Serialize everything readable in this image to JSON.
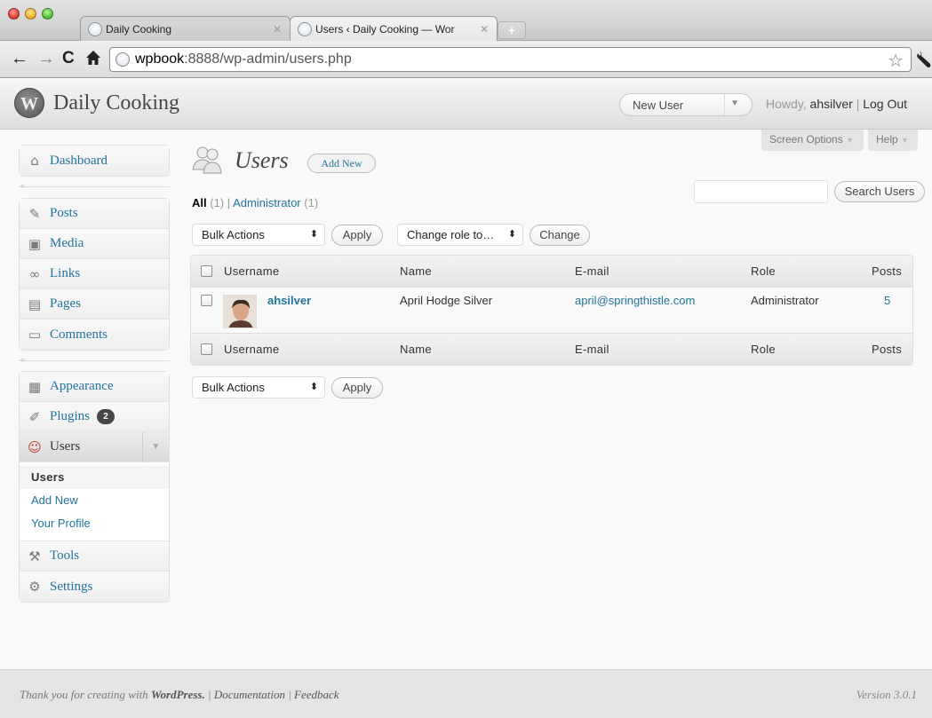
{
  "browser": {
    "tabs": [
      {
        "title": "Daily Cooking",
        "close": "✕"
      },
      {
        "title": "Users ‹ Daily Cooking — Wor",
        "close": "✕"
      }
    ],
    "new_tab": "+",
    "url_host": "wpbook",
    "url_rest": ":8888/wp-admin/users.php"
  },
  "header": {
    "site_title": "Daily Cooking",
    "logo_letter": "W",
    "favorite_action": "New User",
    "howdy": "Howdy,",
    "username": "ahsilver",
    "separator": "|",
    "logout": "Log Out"
  },
  "sidebar": {
    "group1": [
      {
        "label": "Dashboard",
        "icon": "home-icon"
      }
    ],
    "group2": [
      {
        "label": "Posts",
        "icon": "pin-icon"
      },
      {
        "label": "Media",
        "icon": "media-icon"
      },
      {
        "label": "Links",
        "icon": "link-icon"
      },
      {
        "label": "Pages",
        "icon": "pages-icon"
      },
      {
        "label": "Comments",
        "icon": "comment-icon"
      }
    ],
    "group3": [
      {
        "label": "Appearance",
        "icon": "appearance-icon"
      },
      {
        "label": "Plugins",
        "icon": "plugin-icon",
        "badge": "2"
      },
      {
        "label": "Users",
        "icon": "users-icon"
      },
      {
        "label": "Tools",
        "icon": "tools-icon"
      },
      {
        "label": "Settings",
        "icon": "settings-icon"
      }
    ],
    "users_submenu": [
      "Users",
      "Add New",
      "Your Profile"
    ]
  },
  "screen_meta": {
    "screen_options": "Screen Options",
    "help": "Help"
  },
  "page": {
    "title": "Users",
    "add_new": "Add New",
    "filters": {
      "all": "All",
      "all_count": "(1)",
      "sep": "|",
      "admin": "Administrator",
      "admin_count": "(1)"
    },
    "search_button": "Search Users",
    "bulk_actions": "Bulk Actions",
    "apply": "Apply",
    "change_role": "Change role to…",
    "change": "Change"
  },
  "table": {
    "columns": [
      "Username",
      "Name",
      "E-mail",
      "Role",
      "Posts"
    ],
    "rows": [
      {
        "username": "ahsilver",
        "name": "April Hodge Silver",
        "email": "april@springthistle.com",
        "role": "Administrator",
        "posts": "5"
      }
    ]
  },
  "footer": {
    "thank_you": "Thank you for creating with",
    "wordpress": "WordPress.",
    "sep": "|",
    "documentation": "Documentation",
    "feedback": "Feedback",
    "version": "Version 3.0.1"
  },
  "colors": {
    "link": "#21759b",
    "badge": "#464646",
    "header_text": "#464646"
  }
}
